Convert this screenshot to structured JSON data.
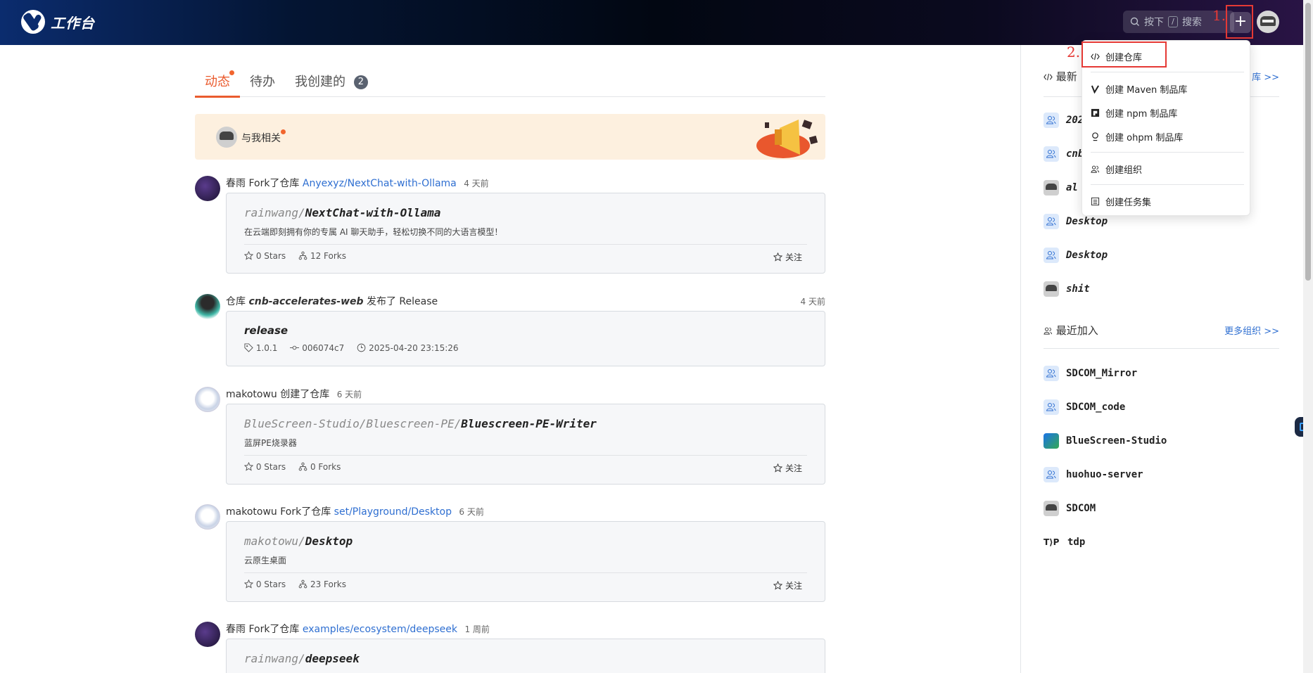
{
  "header": {
    "logo_text": "工作台",
    "search": {
      "prefix": "按下",
      "key": "/",
      "suffix": "搜索"
    },
    "plus_label": "+",
    "annotation_1": "1."
  },
  "tabs": [
    {
      "label": "动态",
      "active": true,
      "dot": true
    },
    {
      "label": "待办"
    },
    {
      "label": "我创建的",
      "count": "2"
    }
  ],
  "banner": {
    "label": "与我相关"
  },
  "feed": [
    {
      "actor": "春雨",
      "action": "Fork了仓库",
      "target": "Anyexyz/NextChat-with-Ollama",
      "time": "4 天前",
      "card": {
        "title_prefix": "rainwang/",
        "title_name": "NextChat-with-Ollama",
        "desc": "在云端即刻拥有你的专属 AI 聊天助手，轻松切换不同的大语言模型！",
        "stars": "0 Stars",
        "forks": "12 Forks",
        "follow": "关注"
      }
    },
    {
      "prefix": "仓库",
      "repo": "cnb-accelerates-web",
      "action": "发布了 Release",
      "time": "4 天前",
      "card": {
        "title_name": "release",
        "tag": "1.0.1",
        "commit": "006074c7",
        "datetime": "2025-04-20 23:15:26"
      }
    },
    {
      "actor": "makotowu",
      "action": "创建了仓库",
      "time": "6 天前",
      "card": {
        "title_prefix": "BlueScreen-Studio/Bluescreen-PE/",
        "title_name": "Bluescreen-PE-Writer",
        "desc": "蓝屏PE烧录器",
        "stars": "0 Stars",
        "forks": "0 Forks",
        "follow": "关注"
      }
    },
    {
      "actor": "makotowu",
      "action": "Fork了仓库",
      "target": "set/Playground/Desktop",
      "time": "6 天前",
      "card": {
        "title_prefix": "makotowu/",
        "title_name": "Desktop",
        "desc": "云原生桌面",
        "stars": "0 Stars",
        "forks": "23 Forks",
        "follow": "关注"
      }
    },
    {
      "actor": "春雨",
      "action": "Fork了仓库",
      "target": "examples/ecosystem/deepseek",
      "time": "1 周前",
      "card": {
        "title_prefix": "rainwang/",
        "title_name": "deepseek"
      }
    }
  ],
  "right": {
    "recent_title": "最新",
    "recent_more": "库 >>",
    "recent_items": [
      "202",
      "cnb",
      "al",
      "Desktop",
      "Desktop",
      "shit"
    ],
    "joined_title": "最近加入",
    "joined_more": "更多组织 >>",
    "joined_items": [
      "SDCOM_Mirror",
      "SDCOM_code",
      "BlueScreen-Studio",
      "huohuo-server",
      "SDCOM",
      "tdp"
    ],
    "tdp_icon_text": "T⟩P"
  },
  "dropdown": {
    "annotation_2": "2.",
    "items": [
      {
        "icon": "code-icon",
        "label": "创建仓库"
      },
      {
        "icon": "maven-icon",
        "label": "创建 Maven 制品库"
      },
      {
        "icon": "npm-icon",
        "label": "创建 npm 制品库"
      },
      {
        "icon": "ohpm-icon",
        "label": "创建 ohpm 制品库"
      },
      {
        "icon": "org-icon",
        "label": "创建组织"
      },
      {
        "icon": "taskset-icon",
        "label": "创建任务集"
      }
    ]
  }
}
